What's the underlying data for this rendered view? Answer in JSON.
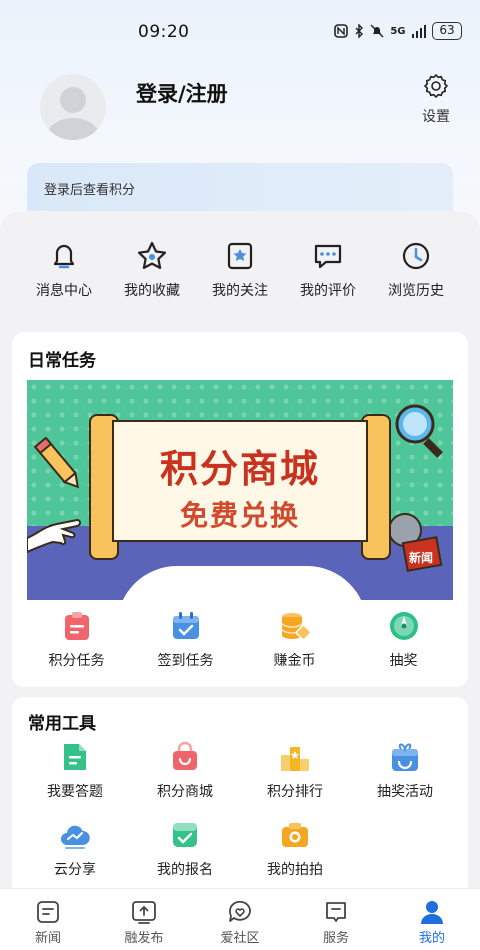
{
  "status_bar": {
    "time": "09:20",
    "network": "5G",
    "battery": "63"
  },
  "profile": {
    "login_label": "登录/注册",
    "settings_label": "设置"
  },
  "points": {
    "hint": "登录后查看积分"
  },
  "quick_actions": [
    {
      "label": "消息中心",
      "icon": "bell-icon"
    },
    {
      "label": "我的收藏",
      "icon": "star-icon"
    },
    {
      "label": "我的关注",
      "icon": "bookmark-star-icon"
    },
    {
      "label": "我的评价",
      "icon": "comment-icon"
    },
    {
      "label": "浏览历史",
      "icon": "clock-icon"
    }
  ],
  "daily_tasks": {
    "title": "日常任务",
    "banner": {
      "line1": "积分商城",
      "line2": "免费兑换",
      "news_tag": "新闻"
    },
    "items": [
      {
        "label": "积分任务",
        "icon": "clipboard-icon",
        "color": "#f0646c"
      },
      {
        "label": "签到任务",
        "icon": "calendar-check-icon",
        "color": "#4a90e2"
      },
      {
        "label": "赚金币",
        "icon": "coins-icon",
        "color": "#f5a623"
      },
      {
        "label": "抽奖",
        "icon": "spinner-icon",
        "color": "#2fbf8a"
      }
    ]
  },
  "tools": {
    "title": "常用工具",
    "items": [
      {
        "label": "我要答题",
        "icon": "answer-doc-icon",
        "color": "#35c28a"
      },
      {
        "label": "积分商城",
        "icon": "shopping-bag-icon",
        "color": "#f0646c"
      },
      {
        "label": "积分排行",
        "icon": "podium-icon",
        "color": "#f5b623"
      },
      {
        "label": "抽奖活动",
        "icon": "prize-box-icon",
        "color": "#4a90e2"
      },
      {
        "label": "云分享",
        "icon": "cloud-share-icon",
        "color": "#4a90e2"
      },
      {
        "label": "我的报名",
        "icon": "signup-check-icon",
        "color": "#35c28a"
      },
      {
        "label": "我的拍拍",
        "icon": "camera-icon",
        "color": "#f5a623"
      }
    ]
  },
  "tabbar": [
    {
      "label": "新闻",
      "icon": "news-tab-icon",
      "active": false
    },
    {
      "label": "融发布",
      "icon": "publish-tab-icon",
      "active": false
    },
    {
      "label": "爱社区",
      "icon": "community-tab-icon",
      "active": false
    },
    {
      "label": "服务",
      "icon": "service-tab-icon",
      "active": false
    },
    {
      "label": "我的",
      "icon": "profile-tab-icon",
      "active": true
    }
  ],
  "colors": {
    "accent": "#1f6fe0",
    "banner_green": "#4fc69a",
    "banner_red": "#c9321e"
  }
}
